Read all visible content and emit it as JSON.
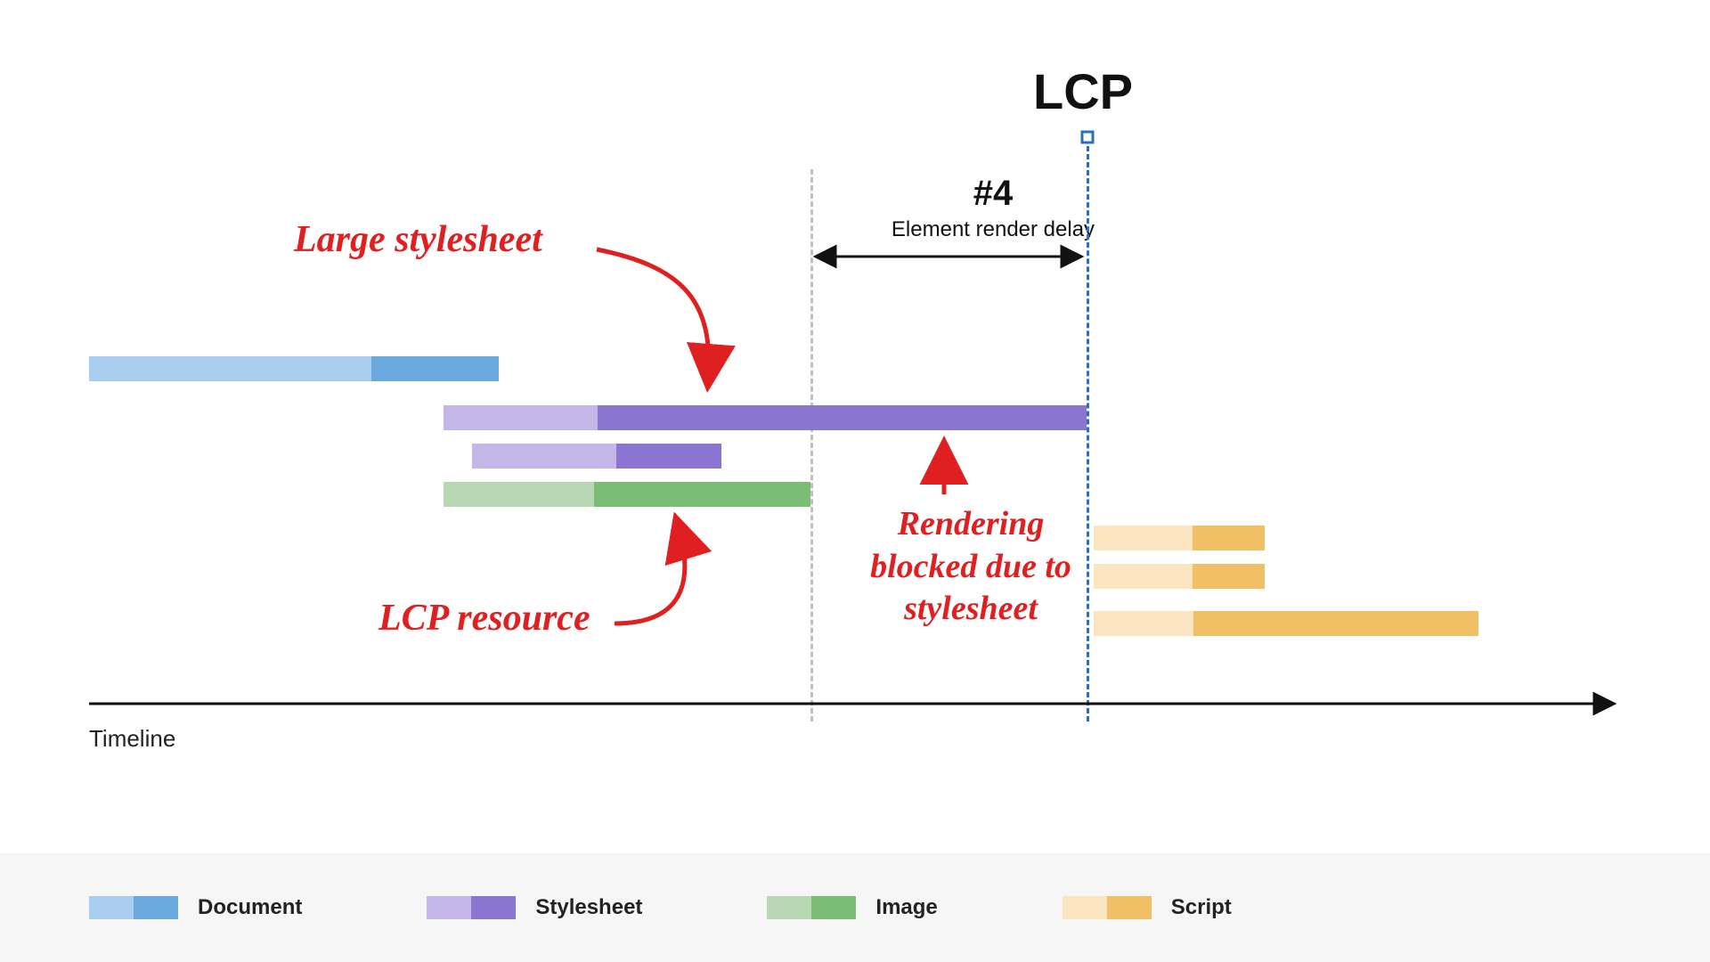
{
  "title": "LCP",
  "phase": {
    "num": "#4",
    "label": "Element render delay"
  },
  "annotations": {
    "large_stylesheet": "Large stylesheet",
    "lcp_resource": "LCP resource",
    "blocked": "Rendering blocked due to stylesheet"
  },
  "axis_label": "Timeline",
  "legend": {
    "document": "Document",
    "stylesheet": "Stylesheet",
    "image": "Image",
    "script": "Script"
  },
  "colors": {
    "doc_light": "#a9cdef",
    "doc_dark": "#6aa8de",
    "sty_light": "#c4b6e6",
    "sty_dark": "#8a75d1",
    "img_light": "#b7d8b2",
    "img_dark": "#7bbd74",
    "scr_light": "#fbe5c0",
    "scr_dark": "#f1c066",
    "red": "#e02020",
    "black": "#111",
    "blue": "#2b6fc2"
  },
  "chart_data": {
    "type": "bar",
    "axis": "Timeline (relative units 0–100)",
    "markers": {
      "render_delay_start": 48.5,
      "lcp": 72
    },
    "bars": [
      {
        "name": "document",
        "type": "Document",
        "row": 0,
        "start": 0,
        "split": 18.5,
        "end": 27
      },
      {
        "name": "large-stylesheet",
        "type": "Stylesheet",
        "row": 1,
        "start": 23,
        "split": 33,
        "end": 72
      },
      {
        "name": "stylesheet-2",
        "type": "Stylesheet",
        "row": 2,
        "start": 26,
        "split": 36.5,
        "end": 44
      },
      {
        "name": "lcp-image",
        "type": "Image",
        "row": 3,
        "start": 23,
        "split": 33,
        "end": 48.5
      },
      {
        "name": "script-1",
        "type": "Script",
        "row": 4,
        "start": 72,
        "split": 79,
        "end": 84
      },
      {
        "name": "script-2",
        "type": "Script",
        "row": 5,
        "start": 72,
        "split": 79,
        "end": 84
      },
      {
        "name": "script-3",
        "type": "Script",
        "row": 6,
        "start": 72,
        "split": 79,
        "end": 100
      }
    ]
  }
}
